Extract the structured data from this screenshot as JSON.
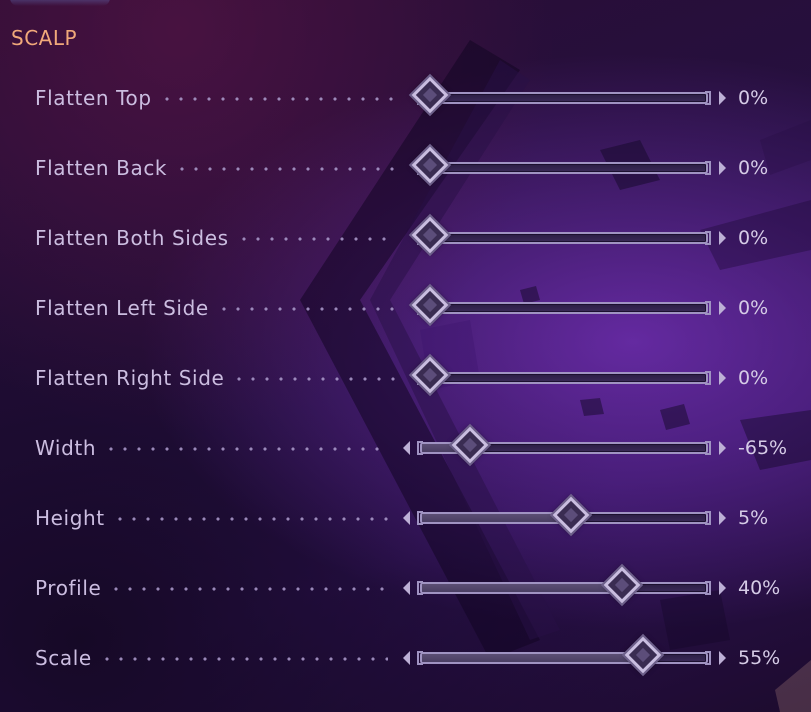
{
  "section": {
    "title": "SCALP"
  },
  "sliders": [
    {
      "label": "Flatten Top",
      "value_text": "0%",
      "level": 0.0,
      "bidirectional": false
    },
    {
      "label": "Flatten Back",
      "value_text": "0%",
      "level": 0.0,
      "bidirectional": false
    },
    {
      "label": "Flatten Both Sides",
      "value_text": "0%",
      "level": 0.0,
      "bidirectional": false
    },
    {
      "label": "Flatten Left Side",
      "value_text": "0%",
      "level": 0.0,
      "bidirectional": false
    },
    {
      "label": "Flatten Right Side",
      "value_text": "0%",
      "level": 0.0,
      "bidirectional": false
    },
    {
      "label": "Width",
      "value_text": "-65%",
      "level": 0.175,
      "bidirectional": true
    },
    {
      "label": "Height",
      "value_text": "5%",
      "level": 0.525,
      "bidirectional": true
    },
    {
      "label": "Profile",
      "value_text": "40%",
      "level": 0.7,
      "bidirectional": true
    },
    {
      "label": "Scale",
      "value_text": "55%",
      "level": 0.775,
      "bidirectional": true
    }
  ],
  "colors": {
    "title": "#f0a87a",
    "label": "#cbbde0",
    "value": "#d5cbe6",
    "track_border": "#a093c2",
    "thumb_border": "#c9bde0"
  },
  "icons": {
    "decrement": "left-arrow-icon",
    "increment": "right-arrow-icon",
    "handle": "diamond-handle-icon"
  }
}
